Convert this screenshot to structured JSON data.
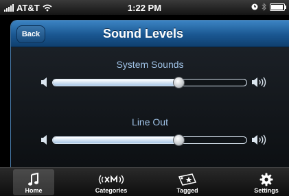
{
  "status_bar": {
    "carrier": "AT&T",
    "time": "1:22 PM",
    "icons": [
      "signal-bars-icon",
      "wifi-icon",
      "clock-icon",
      "bluetooth-icon",
      "battery-icon"
    ]
  },
  "nav": {
    "back_label": "Back",
    "title": "Sound Levels"
  },
  "sliders": [
    {
      "label": "System Sounds",
      "level_percent": 65
    },
    {
      "label": "Line Out",
      "level_percent": 65
    }
  ],
  "tabs": [
    {
      "label": "Home",
      "icon": "music-note-icon",
      "selected": true
    },
    {
      "label": "Categories",
      "icon": "xm-logo-icon",
      "selected": false
    },
    {
      "label": "Tagged",
      "icon": "tag-icon",
      "selected": false
    },
    {
      "label": "Settings",
      "icon": "gear-icon",
      "selected": false
    }
  ],
  "colors": {
    "nav_blue": "#1a5791",
    "label_blue": "#9fc2e6",
    "panel_border": "#4a7fb0"
  }
}
